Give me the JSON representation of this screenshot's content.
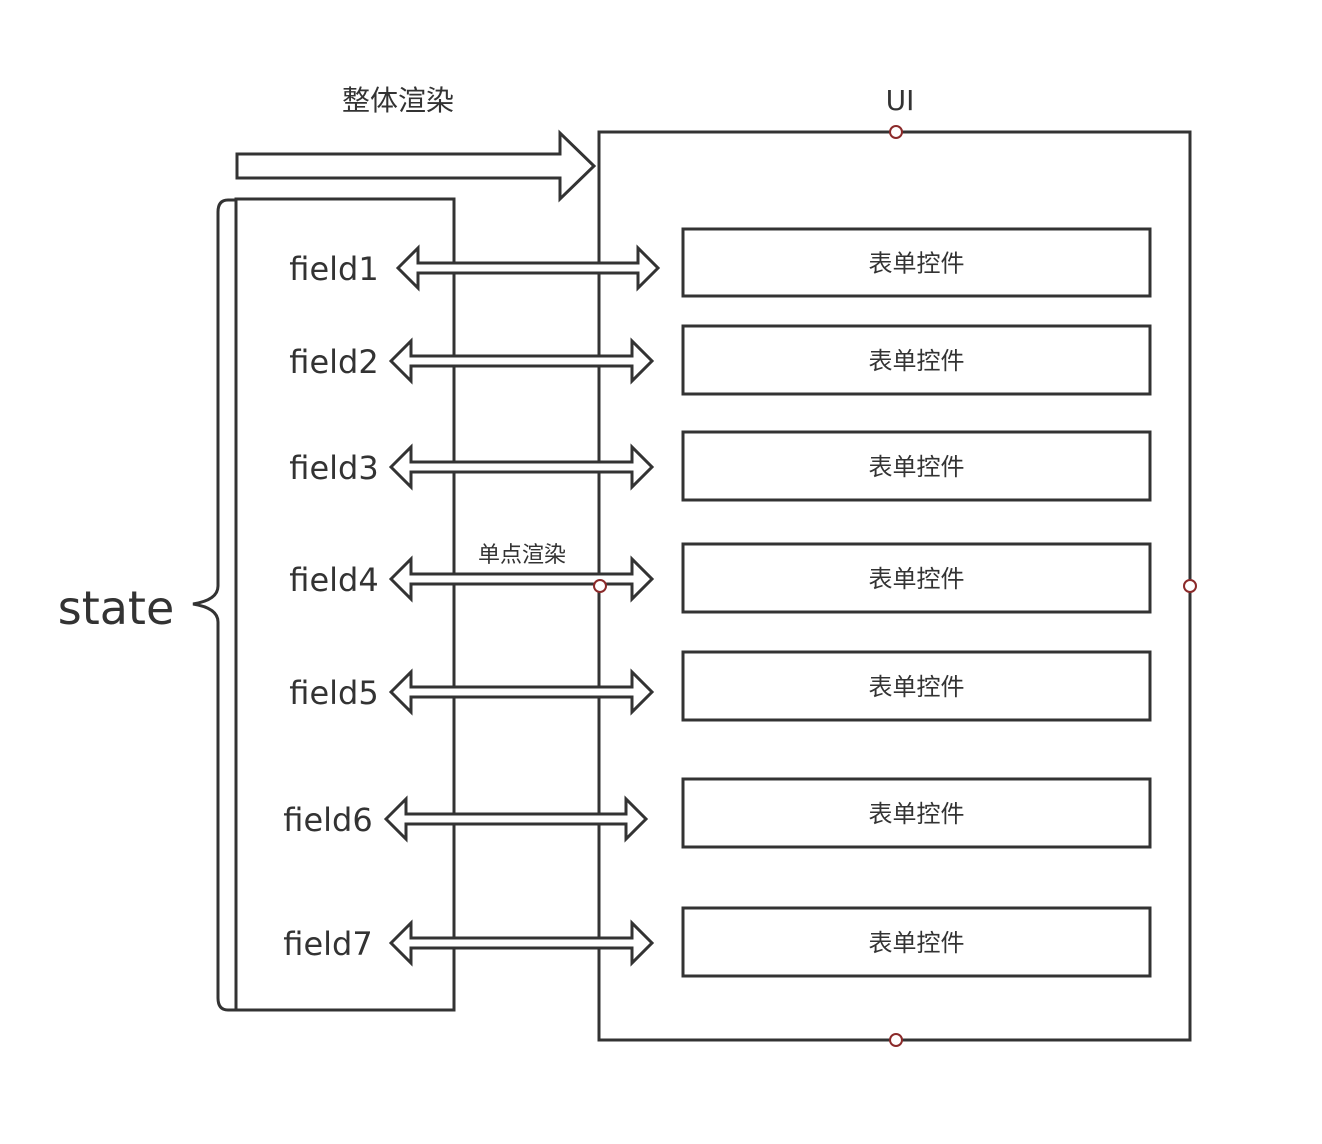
{
  "title_render": "整体渲染",
  "ui_label": "UI",
  "state_label": "state",
  "single_render_label": "单点渲染",
  "fields": [
    "field1",
    "field2",
    "field3",
    "field4",
    "field5",
    "field6",
    "field7"
  ],
  "control_label": "表单控件",
  "colors": {
    "stroke": "#333333",
    "handle": "#8b2a2a",
    "background": "#ffffff"
  }
}
